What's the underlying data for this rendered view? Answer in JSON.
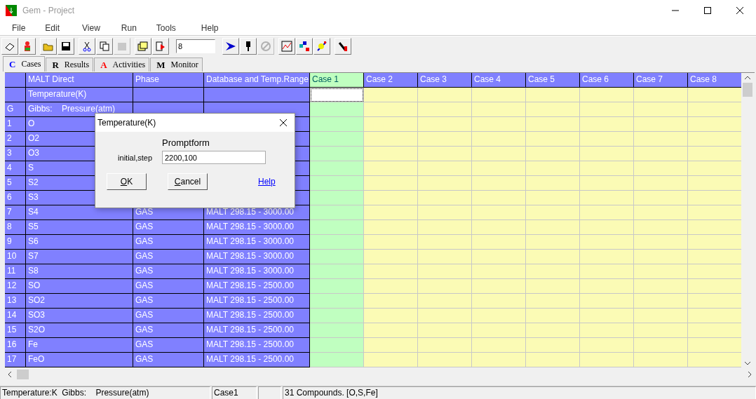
{
  "window": {
    "title": "Gem - Project"
  },
  "menu": [
    "File",
    "Edit",
    "View",
    "Run",
    "Tools",
    "Help"
  ],
  "toolbar": {
    "groups": [
      [
        {
          "disabled": false
        },
        {
          "disabled": false
        }
      ],
      [
        {
          "disabled": false
        },
        {
          "disabled": false
        }
      ],
      [
        {
          "disabled": false
        },
        {
          "disabled": false
        },
        {
          "disabled": true
        }
      ],
      [
        {
          "disabled": false
        },
        {
          "disabled": false
        }
      ],
      [
        {
          "kind": "field",
          "value": "8"
        }
      ],
      [
        {
          "disabled": false
        },
        {
          "disabled": false
        },
        {
          "disabled": true
        }
      ],
      [
        {
          "disabled": false
        },
        {
          "disabled": false
        },
        {
          "disabled": false
        }
      ],
      [
        {
          "disabled": false
        }
      ]
    ]
  },
  "tabs": [
    {
      "glyph": "C",
      "label": "Cases",
      "color": "#0000ff",
      "selected": true
    },
    {
      "glyph": "R",
      "label": "Results",
      "color": "#000000",
      "selected": false
    },
    {
      "glyph": "A",
      "label": "Activities",
      "color": "#ff0000",
      "selected": false
    },
    {
      "glyph": "M",
      "label": "Monitor",
      "color": "#000000",
      "selected": false
    }
  ],
  "grid": {
    "columns": [
      "MALT Direct",
      "Phase",
      "Database and Temp.Range"
    ],
    "cases": [
      {
        "label": "Case 1",
        "selected": true
      },
      {
        "label": "Case 2",
        "selected": false
      },
      {
        "label": "Case 3",
        "selected": false
      },
      {
        "label": "Case 4",
        "selected": false
      },
      {
        "label": "Case 5",
        "selected": false
      },
      {
        "label": "Case 6",
        "selected": false
      },
      {
        "label": "Case 7",
        "selected": false
      },
      {
        "label": "Case 8",
        "selected": false
      }
    ],
    "rows": [
      {
        "name": "Temperature(K)",
        "focused": true
      },
      {
        "index": "G",
        "name": "Gibbs:    Pressure(atm)",
        "focused": false
      },
      {
        "index": "1",
        "name": "O",
        "focused": false
      },
      {
        "index": "2",
        "name": "O2",
        "focused": false
      },
      {
        "index": "3",
        "name": "O3",
        "focused": false
      },
      {
        "index": "4",
        "name": "S",
        "focused": false
      },
      {
        "index": "5",
        "name": "S2",
        "focused": false
      },
      {
        "index": "6",
        "name": "S3",
        "focused": false
      },
      {
        "index": "7",
        "name": "S4",
        "phase": "GAS",
        "database": "MALT 298.15 - 3000.00",
        "focused": false
      },
      {
        "index": "8",
        "name": "S5",
        "phase": "GAS",
        "database": "MALT 298.15 - 3000.00",
        "focused": false
      },
      {
        "index": "9",
        "name": "S6",
        "phase": "GAS",
        "database": "MALT 298.15 - 3000.00",
        "focused": false
      },
      {
        "index": "10",
        "name": "S7",
        "phase": "GAS",
        "database": "MALT 298.15 - 3000.00",
        "focused": false
      },
      {
        "index": "11",
        "name": "S8",
        "phase": "GAS",
        "database": "MALT 298.15 - 3000.00",
        "focused": false
      },
      {
        "index": "12",
        "name": "SO",
        "phase": "GAS",
        "database": "MALT 298.15 - 2500.00",
        "focused": false
      },
      {
        "index": "13",
        "name": "SO2",
        "phase": "GAS",
        "database": "MALT 298.15 - 2500.00",
        "focused": false
      },
      {
        "index": "14",
        "name": "SO3",
        "phase": "GAS",
        "database": "MALT 298.15 - 2500.00",
        "focused": false
      },
      {
        "index": "15",
        "name": "S2O",
        "phase": "GAS",
        "database": "MALT 298.15 - 2500.00",
        "focused": false
      },
      {
        "index": "16",
        "name": "Fe",
        "phase": "GAS",
        "database": "MALT 298.15 - 2500.00",
        "focused": false
      },
      {
        "index": "17",
        "name": "FeO",
        "phase": "GAS",
        "database": "MALT 298.15 - 2500.00",
        "focused": false
      }
    ]
  },
  "dialog": {
    "title": "Temperature(K)",
    "heading": "Promptform",
    "label": "initial,step",
    "value": "2200,100",
    "buttons": [
      "OK",
      "Cancel"
    ],
    "link": "Help"
  },
  "status_bar": [
    "Temperature:K  Gibbs:    Pressure(atm)",
    "Case1",
    "31 Compounds. [O,S,Fe]"
  ]
}
